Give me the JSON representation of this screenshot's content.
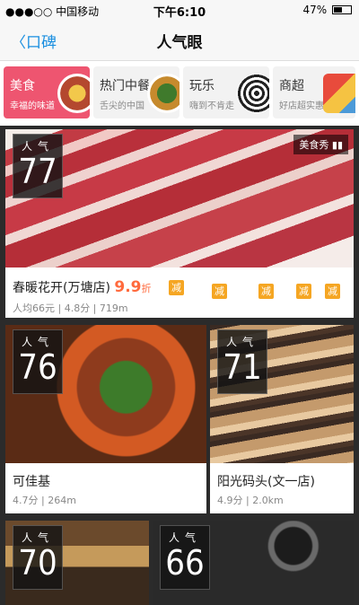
{
  "status_bar": {
    "carrier": "●●●○○ 中国移动",
    "time": "下午6:10",
    "battery": "47%"
  },
  "nav": {
    "back_label": "口碑",
    "title": "人气眼"
  },
  "categories": [
    {
      "label": "美食",
      "sub": "幸福的味道",
      "active": true
    },
    {
      "label": "热门中餐",
      "sub": "舌尖的中国",
      "active": false
    },
    {
      "label": "玩乐",
      "sub": "嗨到不肯走",
      "active": false
    },
    {
      "label": "商超",
      "sub": "好店超实惠",
      "active": false
    }
  ],
  "badge_label": "人气",
  "featured": {
    "popularity": "77",
    "tag": "美食秀",
    "name": "春暖花开(万塘店)",
    "discount": "9.9",
    "discount_unit": "折",
    "promo_badges": [
      "减",
      "减",
      "减",
      "减",
      "减"
    ],
    "meta": "人均66元 | 4.8分 | 719m"
  },
  "cards": [
    {
      "popularity": "76",
      "name": "可佳基",
      "meta": "4.7分 | 264m"
    },
    {
      "popularity": "71",
      "name": "阳光码头(文一店)",
      "meta": "4.9分 | 2.0km"
    },
    {
      "popularity": "70",
      "name": "",
      "meta": ""
    },
    {
      "popularity": "66",
      "name": "",
      "meta": ""
    }
  ],
  "colors": {
    "accent_blue": "#1a8fe0",
    "active_category": "#ee5570",
    "discount": "#ff6a3d",
    "promo_badge": "#f5a623"
  }
}
